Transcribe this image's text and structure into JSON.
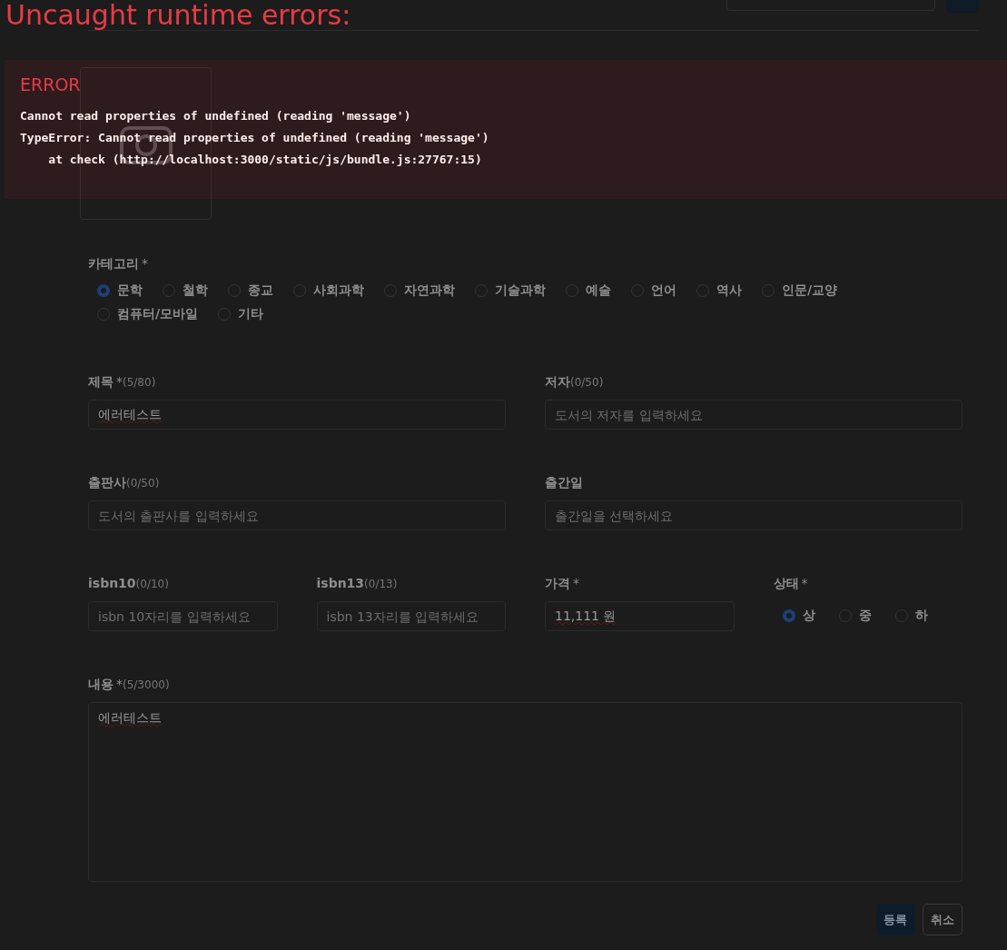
{
  "form": {
    "category": {
      "label": "카테고리",
      "required_mark": "*",
      "options": [
        {
          "label": "문학",
          "selected": true
        },
        {
          "label": "철학",
          "selected": false
        },
        {
          "label": "종교",
          "selected": false
        },
        {
          "label": "사회과학",
          "selected": false
        },
        {
          "label": "자연과학",
          "selected": false
        },
        {
          "label": "기술과학",
          "selected": false
        },
        {
          "label": "예술",
          "selected": false
        },
        {
          "label": "언어",
          "selected": false
        },
        {
          "label": "역사",
          "selected": false
        },
        {
          "label": "인문/교양",
          "selected": false
        },
        {
          "label": "컴퓨터/모바일",
          "selected": false
        },
        {
          "label": "기타",
          "selected": false
        }
      ]
    },
    "rows": [
      [
        {
          "kind": "text",
          "label": "제목",
          "required_mark": "*",
          "counter": "(5/80)",
          "value": "에러테스트"
        },
        {
          "kind": "text",
          "label": "저자",
          "counter": "(0/50)",
          "placeholder": "도서의 저자를 입력하세요"
        }
      ],
      [
        {
          "kind": "text",
          "label": "출판사",
          "counter": "(0/50)",
          "placeholder": "도서의 출판사를 입력하세요"
        },
        {
          "kind": "text",
          "label": "출간일",
          "placeholder": "출간일을 선택하세요"
        }
      ],
      [
        {
          "kind": "text",
          "label": "isbn10",
          "counter": "(0/10)",
          "placeholder": "isbn 10자리를 입력하세요"
        },
        {
          "kind": "text",
          "label": "isbn13",
          "counter": "(0/13)",
          "placeholder": "isbn 13자리를 입력하세요"
        },
        {
          "kind": "text",
          "label": "가격",
          "required_mark": "*",
          "value": "11,111 원"
        },
        {
          "kind": "radio",
          "label": "상태",
          "required_mark": "*",
          "options": [
            {
              "label": "상",
              "selected": true
            },
            {
              "label": "중",
              "selected": false
            },
            {
              "label": "하",
              "selected": false
            }
          ]
        }
      ],
      [
        {
          "kind": "textarea",
          "label": "내용",
          "required_mark": "*",
          "counter": "(5/3000)",
          "value": "에러테스트"
        }
      ]
    ],
    "buttons": [
      {
        "label": "등록",
        "kind": "primary"
      },
      {
        "label": "취소",
        "kind": "secondary"
      }
    ]
  },
  "error_overlay": {
    "title": "Uncaught runtime errors:",
    "label": "ERROR",
    "lines": [
      "Cannot read properties of undefined (reading 'message')",
      "TypeError: Cannot read properties of undefined (reading 'message')",
      "    at check (http://localhost:3000/static/js/bundle.js:27767:15)"
    ]
  }
}
